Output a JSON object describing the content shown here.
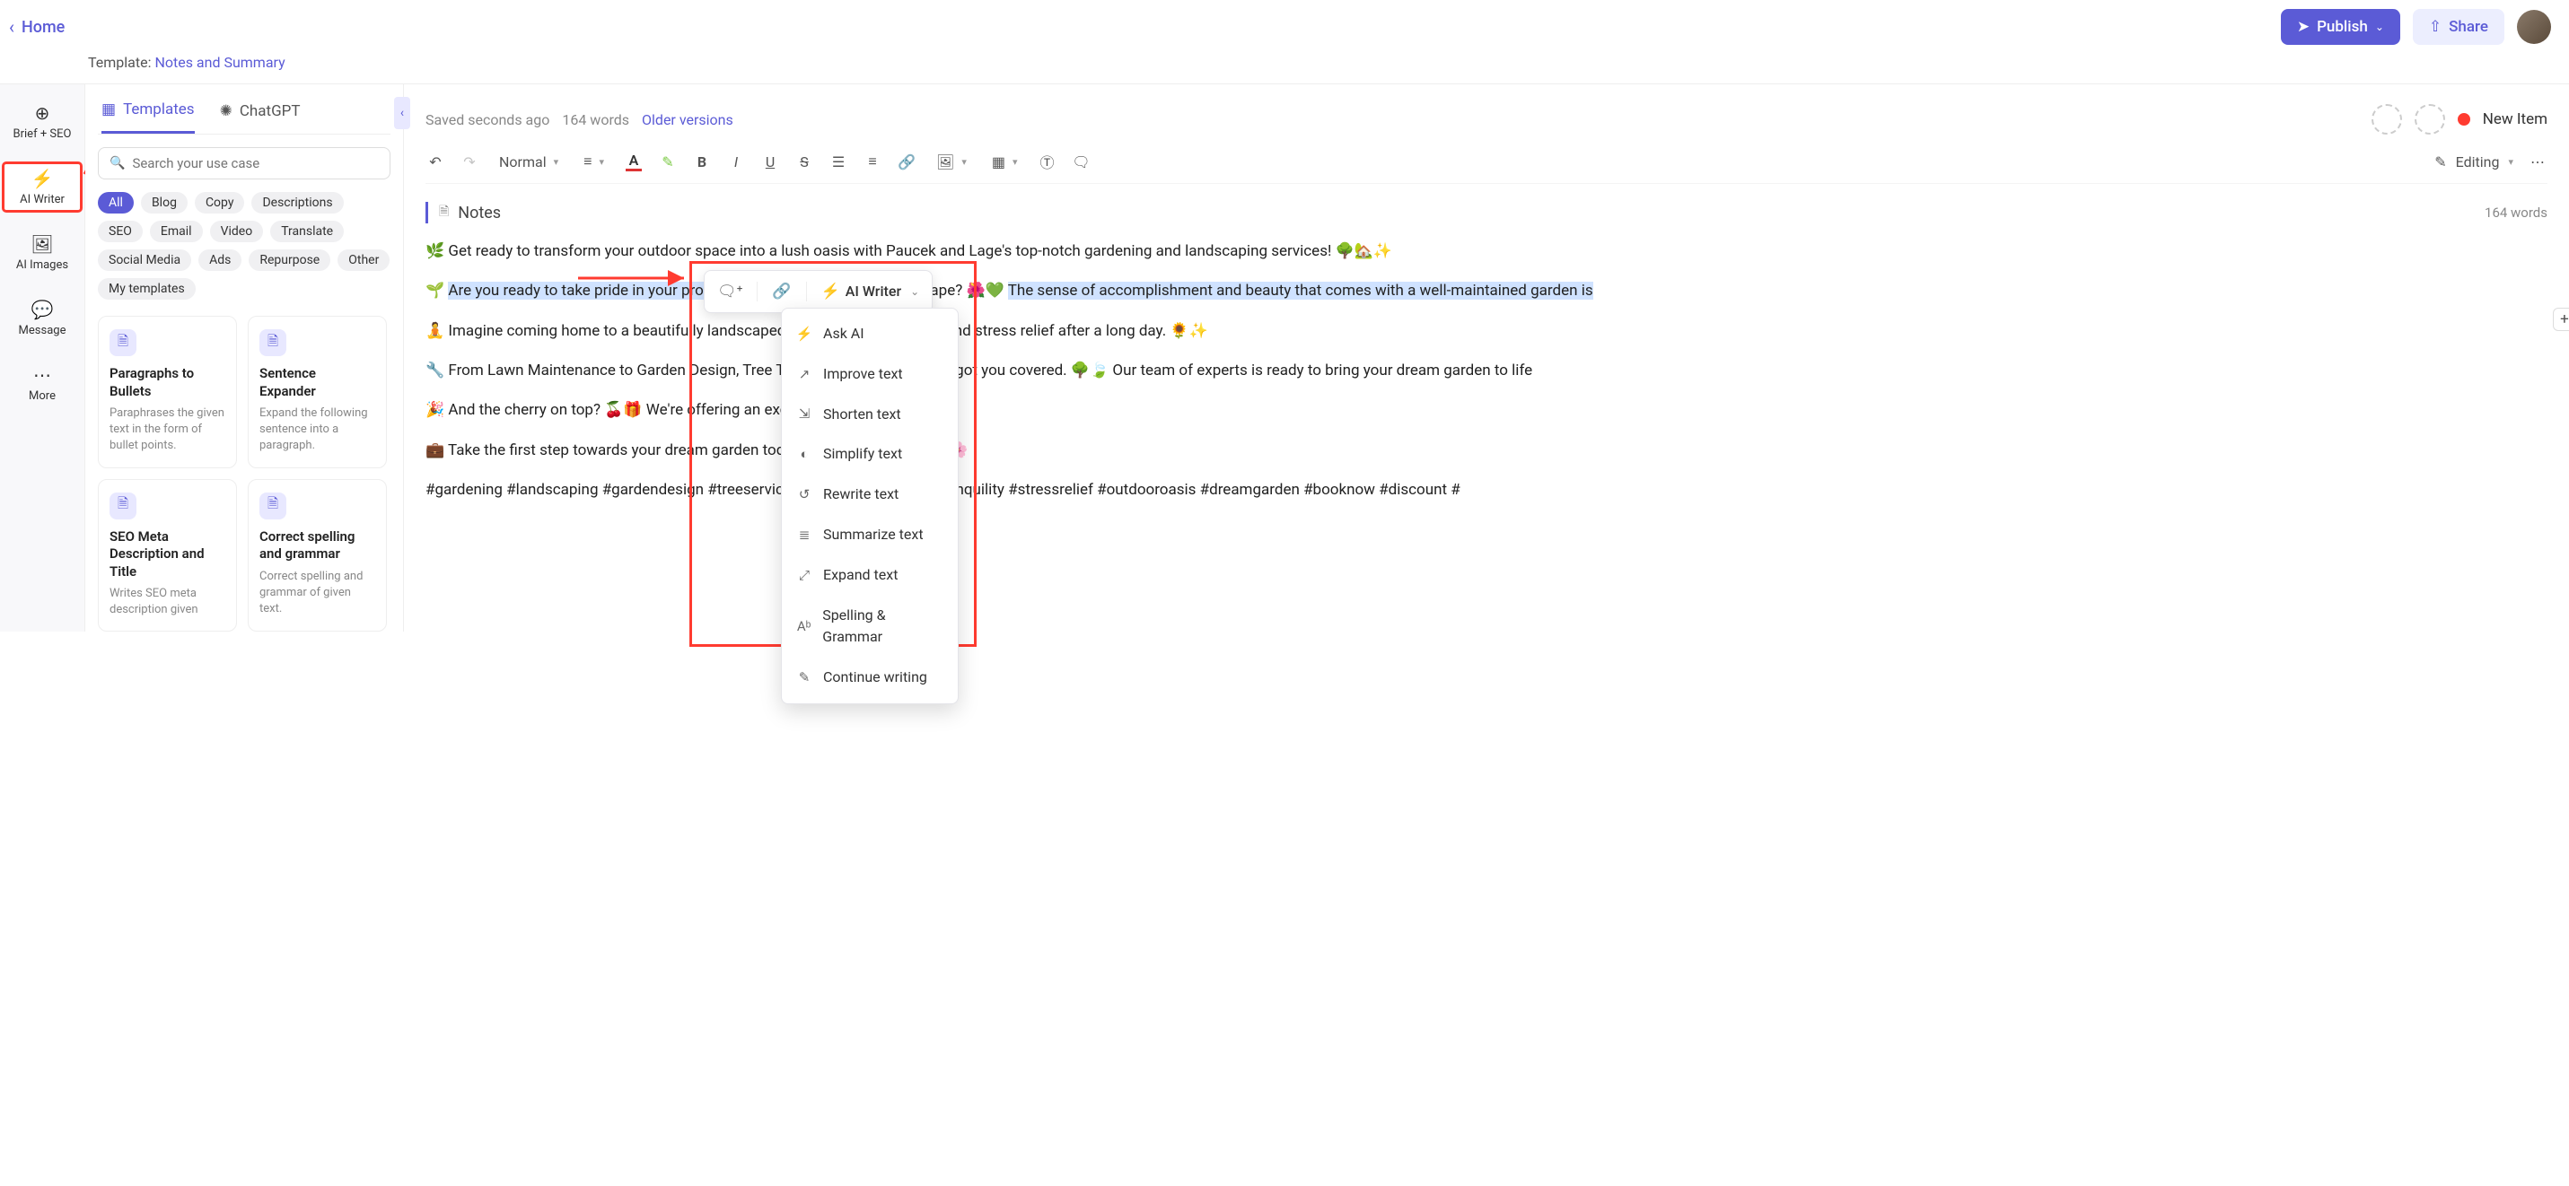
{
  "header": {
    "home": "Home",
    "template_label": "Template: ",
    "template_name": "Notes and Summary",
    "publish": "Publish",
    "share": "Share"
  },
  "rail": {
    "brief": "Brief + SEO",
    "ai_writer": "AI Writer",
    "ai_images": "AI Images",
    "message": "Message",
    "more": "More"
  },
  "panel": {
    "tab_templates": "Templates",
    "tab_chatgpt": "ChatGPT",
    "search_placeholder": "Search your use case",
    "tags": [
      "All",
      "Blog",
      "Copy",
      "Descriptions",
      "SEO",
      "Email",
      "Video",
      "Translate",
      "Social Media",
      "Ads",
      "Repurpose",
      "Other",
      "My templates"
    ],
    "cards": [
      {
        "title": "Paragraphs to Bullets",
        "desc": "Paraphrases the given text in the form of bullet points."
      },
      {
        "title": "Sentence Expander",
        "desc": "Expand the following sentence into a paragraph."
      },
      {
        "title": "SEO Meta Description and Title",
        "desc": "Writes SEO meta description given"
      },
      {
        "title": "Correct spelling and grammar",
        "desc": "Correct spelling and grammar of given text."
      }
    ]
  },
  "editor": {
    "saved": "Saved seconds ago",
    "words_top": "164 words",
    "older": "Older versions",
    "new_item": "New Item",
    "style": "Normal",
    "mode": "Editing",
    "notes_label": "Notes",
    "word_count": "164 words"
  },
  "doc": {
    "p1": "🌿 Get ready to transform your outdoor space into a lush oasis with Paucek and Lage's top-notch gardening and landscaping services! 🌳🏡✨",
    "p2a": "🌱 ",
    "p2b": "Are you ready to take pride in your property and e",
    "p2c": " landscape? 🌺💚 ",
    "p2d": "The sense of accomplishment and beauty that comes with a well-maintained garden is",
    "p3": "🧘 Imagine coming home to a beautifully landscaped y that offers relaxation and stress relief after a long day. 🌻✨",
    "p4": "🔧 From Lawn Maintenance to Garden Design, Tree T sign, and Mowing, we've got you covered. 🌳🍃 Our team of experts is ready to bring your dream garden to life",
    "p5": "🎉 And the cherry on top? 🍒🎁 We're offering an excl ur first booking! 💰🤩",
    "p6": "💼 Take the first step towards your dream garden tod t us work our magic! ✨🌸",
    "p7": "#gardening #landscaping #gardendesign #treeservic eenon #greenthumb #tranquility #stressrelief #outdooroasis #dreamgarden #booknow #discount #"
  },
  "bubble": {
    "ai_writer": "AI Writer"
  },
  "menu": {
    "items": [
      {
        "icon": "⚡",
        "label": "Ask AI"
      },
      {
        "icon": "↗",
        "label": "Improve text"
      },
      {
        "icon": "⇲",
        "label": "Shorten text"
      },
      {
        "icon": "◐",
        "label": "Simplify text"
      },
      {
        "icon": "↺",
        "label": "Rewrite text"
      },
      {
        "icon": "≣",
        "label": "Summarize text"
      },
      {
        "icon": "⤢",
        "label": "Expand text"
      },
      {
        "icon": "Aᵇ",
        "label": "Spelling & Grammar"
      },
      {
        "icon": "✎",
        "label": "Continue writing"
      }
    ]
  }
}
